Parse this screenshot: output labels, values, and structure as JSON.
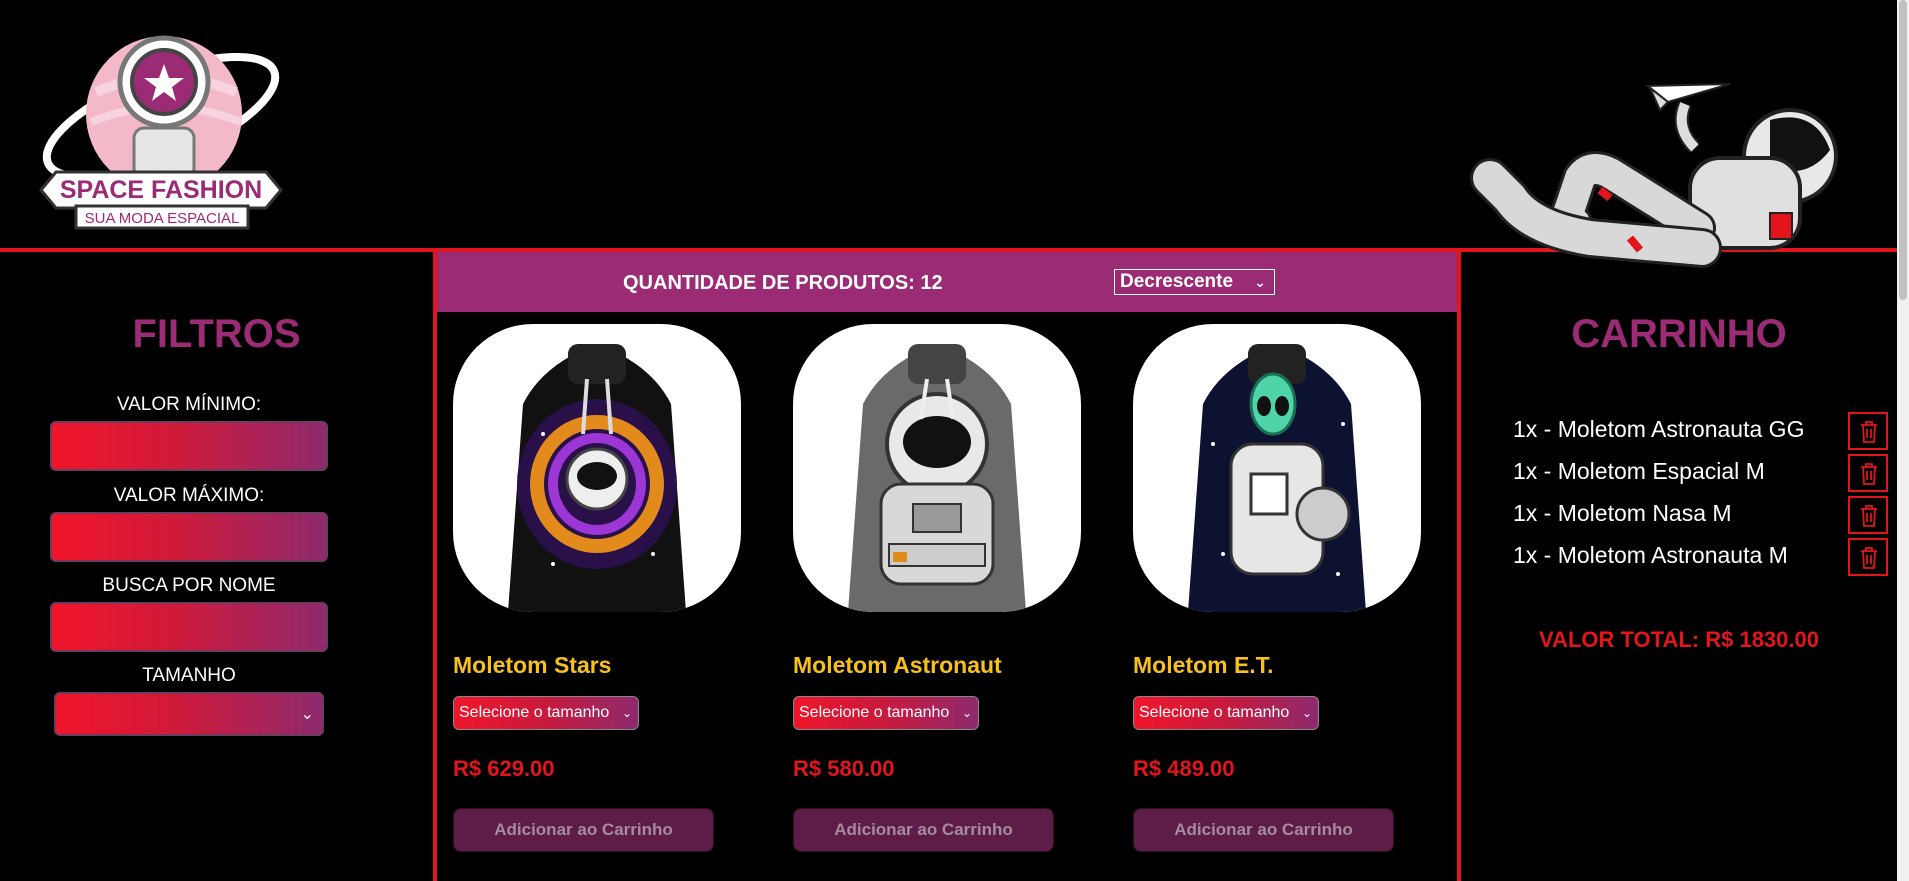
{
  "brand": {
    "name": "SPACE FASHION",
    "tagline": "SUA MODA ESPACIAL",
    "primary_color": "#9b2b74",
    "accent_color": "#e3151c",
    "title_color": "#f6c11a"
  },
  "filters": {
    "title": "FILTROS",
    "min_label": "VALOR MÍNIMO:",
    "min_value": "",
    "max_label": "VALOR MÁXIMO:",
    "max_value": "",
    "search_label": "BUSCA POR NOME",
    "search_value": "",
    "size_label": "TAMANHO",
    "size_selected": ""
  },
  "products_bar": {
    "quantity_label": "QUANTIDADE DE PRODUTOS: 12",
    "sort_selected": "Decrescente"
  },
  "products": [
    {
      "name": "Moletom Stars",
      "size_placeholder": "Selecione o tamanho",
      "price": "R$ 629.00",
      "button": "Adicionar ao Carrinho"
    },
    {
      "name": "Moletom Astronaut",
      "size_placeholder": "Selecione o tamanho",
      "price": "R$ 580.00",
      "button": "Adicionar ao Carrinho"
    },
    {
      "name": "Moletom E.T.",
      "size_placeholder": "Selecione o tamanho",
      "price": "R$ 489.00",
      "button": "Adicionar ao Carrinho"
    }
  ],
  "cart": {
    "title": "CARRINHO",
    "items": [
      "1x - Moletom Astronauta GG",
      "1x - Moletom Espacial M",
      "1x - Moletom Nasa M",
      "1x - Moletom Astronauta M"
    ],
    "total": "VALOR TOTAL: R$ 1830.00"
  }
}
